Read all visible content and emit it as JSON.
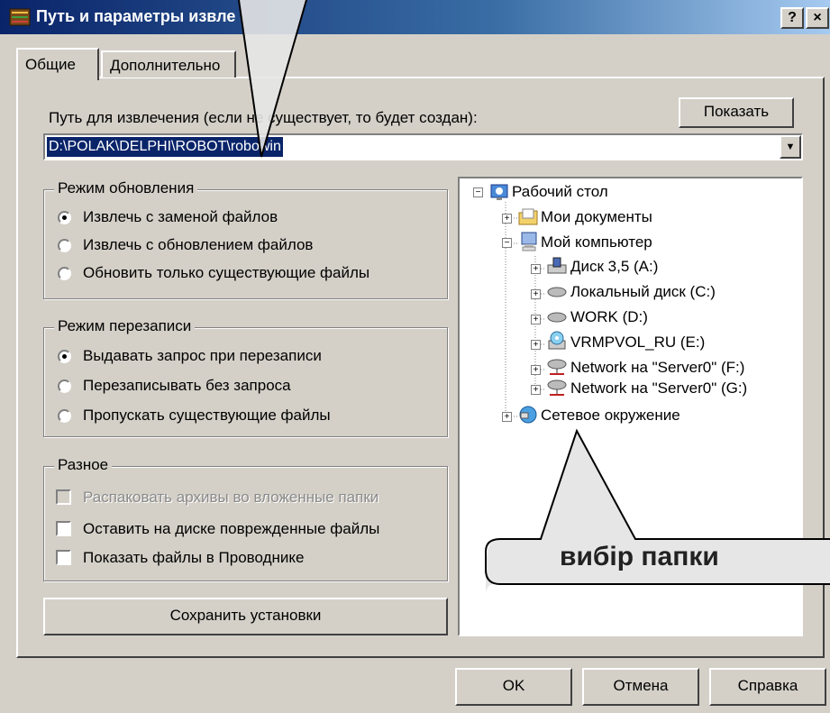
{
  "window": {
    "title": "Путь и параметры извле",
    "help_btn": "?",
    "close_btn": "×"
  },
  "tabs": [
    {
      "label": "Общие"
    },
    {
      "label": "Дополнительно"
    }
  ],
  "path": {
    "label": "Путь для извлечения (если не существует, то будет создан):",
    "value": "D:\\POLAK\\DELPHI\\ROBOT\\robowin",
    "show_button": "Показать"
  },
  "update_mode": {
    "title": "Режим обновления",
    "options": [
      "Извлечь с заменой файлов",
      "Извлечь с обновлением файлов",
      "Обновить только существующие файлы"
    ],
    "selected": 0
  },
  "overwrite_mode": {
    "title": "Режим перезаписи",
    "options": [
      "Выдавать запрос при перезаписи",
      "Перезаписывать без запроса",
      "Пропускать существующие файлы"
    ],
    "selected": 0
  },
  "misc": {
    "title": "Разное",
    "options": [
      {
        "label": "Распаковать архивы во вложенные папки",
        "disabled": true,
        "checked": false
      },
      {
        "label": "Оставить на диске поврежденные файлы",
        "disabled": false,
        "checked": false
      },
      {
        "label": "Показать файлы в Проводнике",
        "disabled": false,
        "checked": false
      }
    ]
  },
  "save_button": "Сохранить установки",
  "tree": {
    "root": "Рабочий стол",
    "my_docs": "Мои документы",
    "my_computer": "Мой компьютер",
    "drives": [
      "Диск 3,5 (A:)",
      "Локальный диск (C:)",
      "WORK (D:)",
      "VRMPVOL_RU (E:)",
      "Network на \"Server0\" (F:)",
      "Network на \"Server0\" (G:)"
    ],
    "network": "Сетевое окружение"
  },
  "buttons": {
    "ok": "OK",
    "cancel": "Отмена",
    "help": "Справка"
  },
  "callout": {
    "text": "вибір папки"
  }
}
